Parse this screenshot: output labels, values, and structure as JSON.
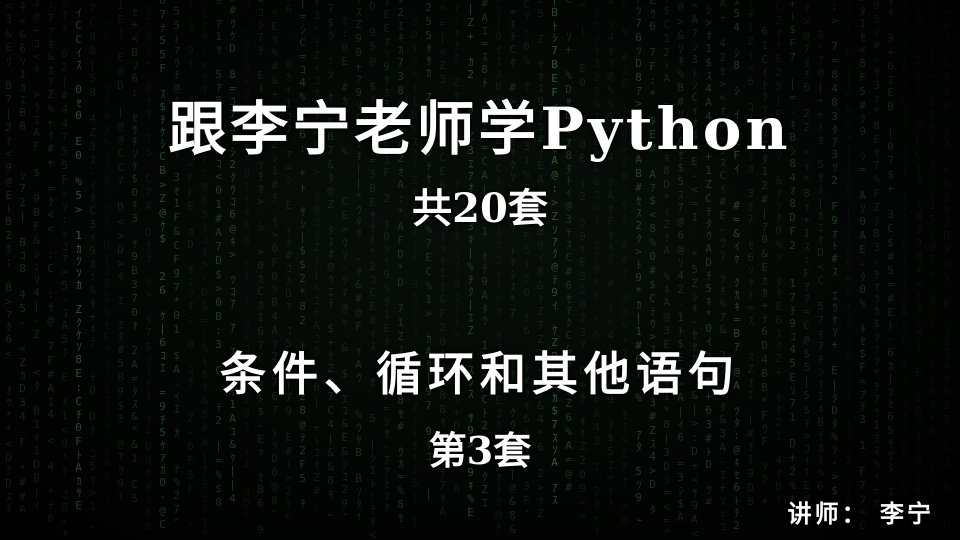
{
  "slide": {
    "title": "跟李宁老师学Python",
    "count": "共20套",
    "topic": "条件、循环和其他语句",
    "set": "第3套",
    "lecturer": "讲师： 李宁"
  },
  "background": {
    "icon": "matrix-rain-pattern",
    "color": "#2f6a33"
  }
}
